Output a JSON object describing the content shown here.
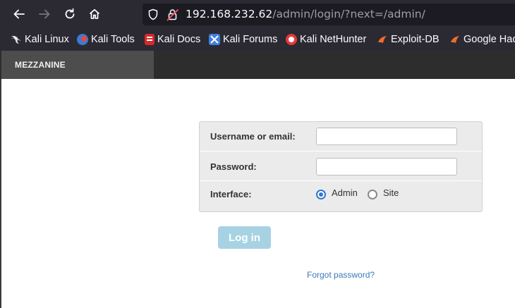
{
  "browser": {
    "url_host": "192.168.232.62",
    "url_path": "/admin/login/?next=/admin/",
    "icons": [
      "back-arrow-icon",
      "forward-arrow-icon",
      "reload-icon",
      "home-icon",
      "shield-icon",
      "insecure-lock-icon"
    ]
  },
  "bookmarks": [
    {
      "label": "Kali Linux",
      "icon": "kali-dragon-icon"
    },
    {
      "label": "Kali Tools",
      "icon": "kali-tools-icon"
    },
    {
      "label": "Kali Docs",
      "icon": "kali-docs-icon"
    },
    {
      "label": "Kali Forums",
      "icon": "kali-forums-icon"
    },
    {
      "label": "Kali NetHunter",
      "icon": "kali-nethunter-icon"
    },
    {
      "label": "Exploit-DB",
      "icon": "exploit-db-icon"
    },
    {
      "label": "Google Hac",
      "icon": "ghdb-icon"
    }
  ],
  "admin": {
    "brand": "MEZZANINE"
  },
  "login": {
    "username_label": "Username or email:",
    "username_value": "",
    "password_label": "Password:",
    "password_value": "",
    "interface_label": "Interface:",
    "interface_options": [
      "Admin",
      "Site"
    ],
    "interface_selected": "Admin",
    "submit_label": "Log in",
    "forgot_label": "Forgot password?"
  },
  "colors": {
    "toolbar_bg": "#2b2a33",
    "header_bg": "#2d2d2d",
    "brand_bg": "#4d4d4d",
    "login_button": "#a7d2e4",
    "link": "#3a7ab8",
    "radio_accent": "#2e77d0"
  }
}
